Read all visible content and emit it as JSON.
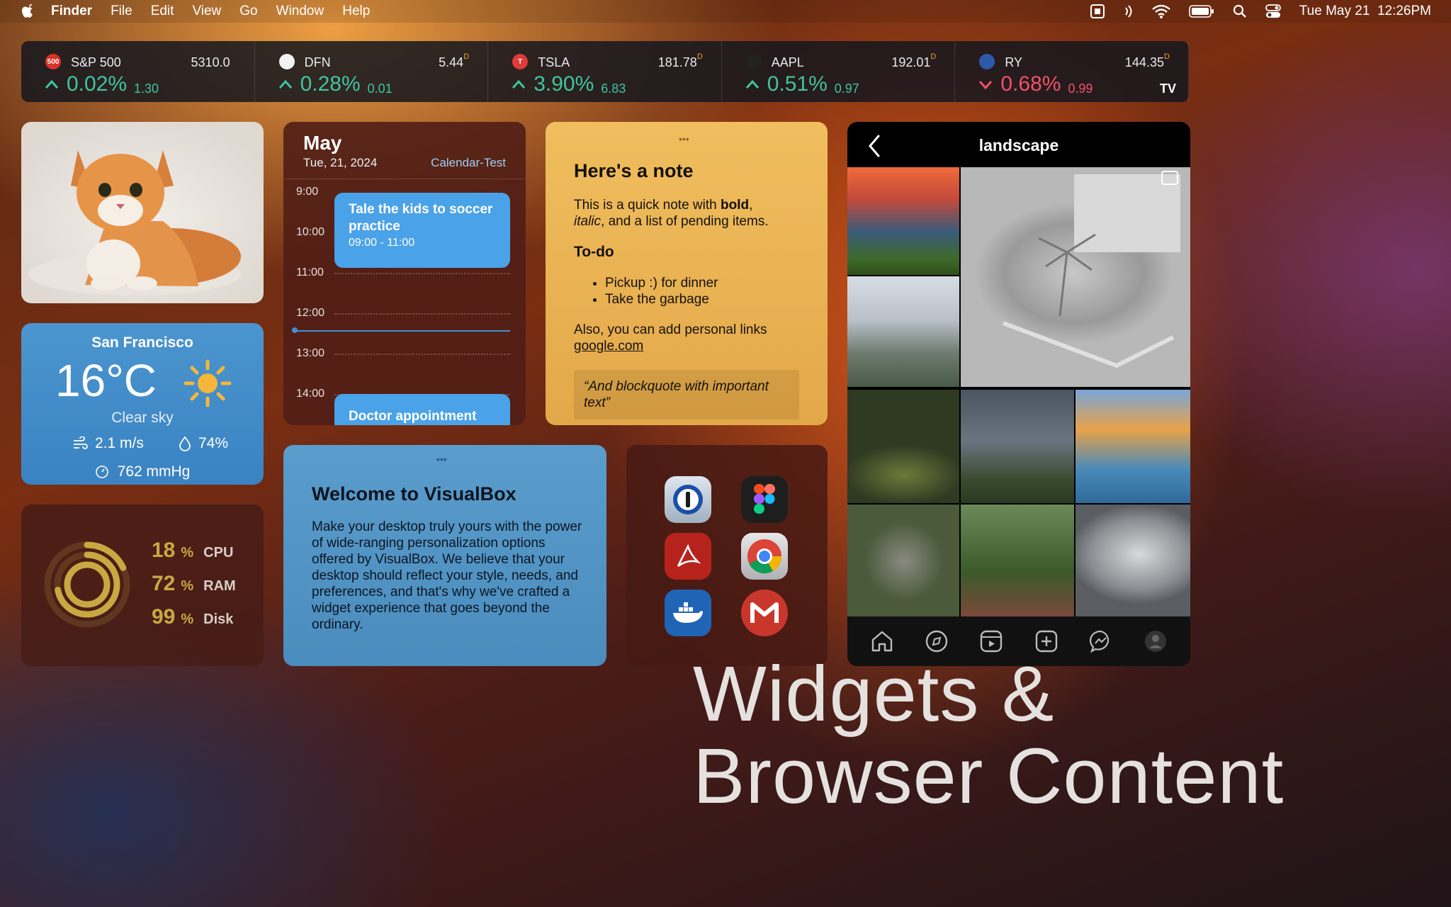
{
  "menubar": {
    "app": "Finder",
    "items": [
      "File",
      "Edit",
      "View",
      "Go",
      "Window",
      "Help"
    ],
    "datetime": "Tue May 21  12:26PM"
  },
  "ticker": [
    {
      "symbol": "S&P 500",
      "price": "5310.0",
      "delayed": "",
      "pct": "0.02%",
      "change": "1.30",
      "direction": "up",
      "logo_text": "500",
      "logo_color": "#d8322a"
    },
    {
      "symbol": "DFN",
      "price": "5.44",
      "delayed": "D",
      "pct": "0.28%",
      "change": "0.01",
      "direction": "up",
      "logo_text": "",
      "logo_color": "#f2f2f2"
    },
    {
      "symbol": "TSLA",
      "price": "181.78",
      "delayed": "D",
      "pct": "3.90%",
      "change": "6.83",
      "direction": "up",
      "logo_text": "T",
      "logo_color": "#e03a3a"
    },
    {
      "symbol": "AAPL",
      "price": "192.01",
      "delayed": "D",
      "pct": "0.51%",
      "change": "0.97",
      "direction": "up",
      "logo_text": "",
      "logo_color": "#222222"
    },
    {
      "symbol": "RY",
      "price": "144.35",
      "delayed": "D",
      "pct": "0.68%",
      "change": "0.99",
      "direction": "down",
      "logo_text": "",
      "logo_color": "#2c5aa8"
    }
  ],
  "ticker_brand": "TV",
  "weather": {
    "city": "San Francisco",
    "temp": "16°C",
    "condition": "Clear sky",
    "wind": "2.1 m/s",
    "humidity": "74%",
    "pressure": "762 mmHg"
  },
  "system": {
    "cpu": "18",
    "ram": "72",
    "disk": "99",
    "unit": "%",
    "labels": {
      "cpu": "CPU",
      "ram": "RAM",
      "disk": "Disk"
    },
    "levels": [
      0.18,
      0.72,
      0.99
    ]
  },
  "calendar": {
    "month": "May",
    "date": "Tue, 21, 2024",
    "name": "Calendar-Test",
    "hours": [
      "9:00",
      "10:00",
      "11:00",
      "12:00",
      "13:00",
      "14:00"
    ],
    "events": [
      {
        "title": "Tale the kids to soccer practice",
        "time": "09:00 - 11:00"
      },
      {
        "title": "Doctor appointment",
        "time": ""
      }
    ]
  },
  "note": {
    "title": "Here's a note",
    "intro_a": "This is a quick note with ",
    "intro_bold": "bold",
    "intro_b": ", ",
    "intro_italic": "italic",
    "intro_c": ", and a list of pending items.",
    "todo_title": "To-do",
    "todos": [
      "Pickup :) for dinner",
      "Take the garbage"
    ],
    "links_text": "Also, you can add personal links",
    "link": "google.com",
    "quote": "“And blockquote with important text”"
  },
  "welcome": {
    "title": "Welcome to VisualBox",
    "body": "Make your desktop truly yours with the power of wide-ranging personalization options offered by VisualBox. We believe that your desktop should reflect your style, needs, and preferences, and that's why we've crafted a widget experience that goes beyond the ordinary."
  },
  "apps": [
    "1password-icon",
    "figma-icon",
    "acrobat-icon",
    "chrome-icon",
    "docker-icon",
    "gmail-icon"
  ],
  "instagram": {
    "title": "landscape"
  },
  "headline": {
    "line1": "Widgets &",
    "line2": "Browser Content"
  }
}
